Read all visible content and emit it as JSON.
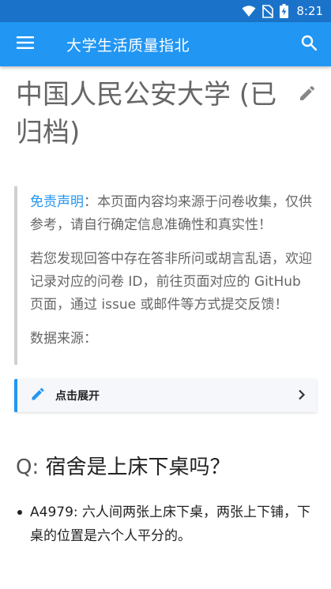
{
  "status_bar": {
    "time": "8:21",
    "icons": [
      "wifi-icon",
      "no-sim-icon",
      "battery-charging-icon"
    ]
  },
  "app_bar": {
    "title": "大学生活质量指北",
    "menu_icon": "menu-icon",
    "search_icon": "search-icon"
  },
  "page": {
    "title": "中国人民公安大学 (已归档)",
    "edit_icon": "pencil-icon"
  },
  "disclaimer": {
    "label": "免责声明",
    "text": "：本页面内容均来源于问卷收集，仅供参考，请自行确定信息准确性和真实性！",
    "feedback": "若您发现回答中存在答非所问或胡言乱语，欢迎记录对应的问卷 ID，前往页面对应的 GitHub 页面，通过 issue 或邮件等方式提交反馈！",
    "source": "数据来源："
  },
  "details": {
    "label": "点击展开",
    "icon": "pencil-icon",
    "chevron": "chevron-right-icon"
  },
  "question": {
    "prefix": "Q:",
    "text": "宿舍是上床下桌吗？"
  },
  "answers": [
    {
      "text": "A4979: 六人间两张上床下桌，两张上下铺，下桌的位置是六个人平分的。"
    }
  ],
  "colors": {
    "primary": "#2196f3",
    "status_bar": "#1a73c9",
    "title_gray": "#666666"
  }
}
